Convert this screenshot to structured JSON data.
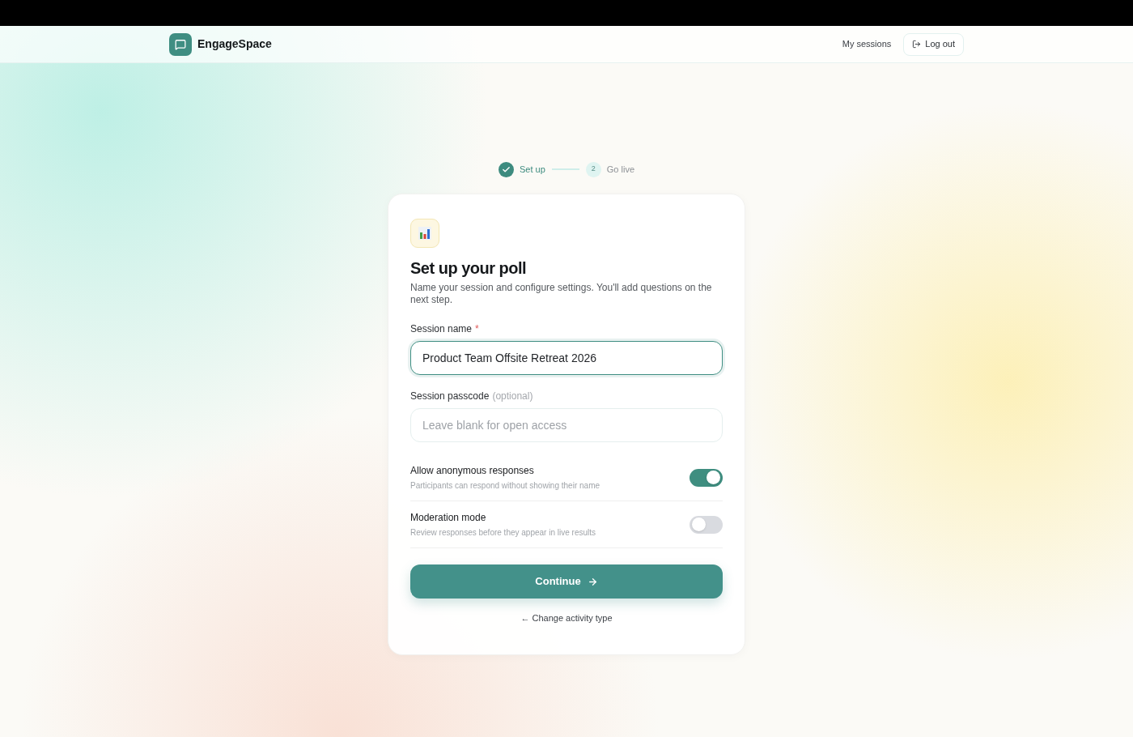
{
  "header": {
    "brand": "EngageSpace",
    "nav_link": "My sessions",
    "logout_button": "Log out"
  },
  "stepper": [
    {
      "label": "Set up",
      "completed": true
    },
    {
      "number": "2",
      "label": "Go live",
      "completed": false
    }
  ],
  "card": {
    "title": "Set up your poll",
    "description": "Name your session and configure settings. You'll add questions on the next step.",
    "fields": [
      {
        "label": "Session name",
        "required_mark": "*",
        "value": "Product Team Offsite Retreat 2026",
        "focused": true
      },
      {
        "label": "Session passcode",
        "hint": "(optional)",
        "placeholder": "Leave blank for open access",
        "focused": false
      }
    ],
    "settings": [
      {
        "title": "Allow anonymous responses",
        "description": "Participants can respond without showing their name",
        "on": true
      },
      {
        "title": "Moderation mode",
        "description": "Review responses before they appear in live results",
        "on": false
      }
    ],
    "primary_button": "Continue",
    "back_link": "← Change activity type"
  }
}
